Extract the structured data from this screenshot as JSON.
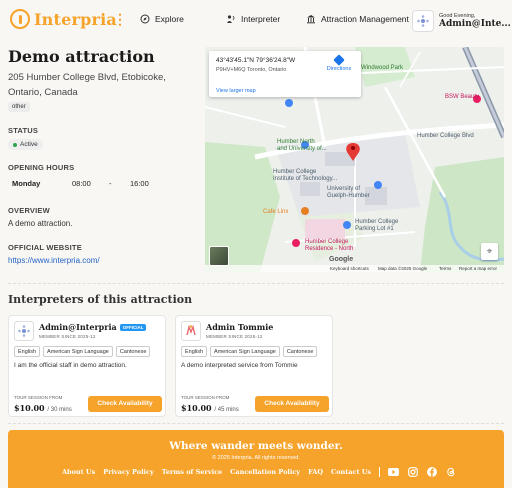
{
  "brand": {
    "name": "Interpria",
    "accent": "#f5a32b"
  },
  "nav": {
    "explore": "Explore",
    "interpreter": "Interpreter",
    "attraction_management": "Attraction Management"
  },
  "user": {
    "greeting": "Good Evening,",
    "name": "Admin@Inte..."
  },
  "attraction": {
    "title": "Demo attraction",
    "address": "205 Humber College Blvd, Etobicoke, Ontario, Canada",
    "tag": "other",
    "status_label": "STATUS",
    "status": "Active",
    "hours_label": "OPENING HOURS",
    "hours": {
      "day": "Monday",
      "open": "08:00",
      "sep": "-",
      "close": "16:00"
    },
    "overview_label": "OVERVIEW",
    "overview": "A demo attraction.",
    "website_label": "OFFICIAL WEBSITE",
    "website": "https://www.interpria.com/"
  },
  "map": {
    "coords": "43°43'45.1\"N 79°36'24.8\"W",
    "plus_code": "P9HV+M6Q Toronto, Ontario",
    "directions": "Directions",
    "larger": "View larger map",
    "labels": {
      "windwood": "Windwood Park",
      "bsw": "BSW Beauty",
      "humber_college_blvd": "Humber College Blvd",
      "humber_north": "Humber North\nand University of...",
      "humber_institute": "Humber College\nInstitute of Technology...",
      "guelph": "University of\nGuelph-Humber",
      "cafe": "Cafe Linx",
      "parking": "Humber College\nParking Lot #1",
      "residence": "Humber College\nResidence - North",
      "google": "Google"
    },
    "footer": {
      "shortcuts": "Keyboard shortcuts",
      "mapdata": "Map data ©2025 Google",
      "terms": "Terms",
      "report": "Report a map error"
    }
  },
  "interpreters": {
    "title": "Interpreters of this attraction",
    "list": [
      {
        "name": "Admin@Interpria",
        "badge": "OFFICIAL",
        "since": "MEMBER SINCE 2025-12",
        "languages": [
          "English",
          "American Sign Language",
          "Cantonese"
        ],
        "description": "I am the official staff in demo attraction.",
        "session_label": "TOUR SESSION FROM",
        "price": "$10.00",
        "duration": "/ 30 mins",
        "cta": "Check Availability"
      },
      {
        "name": "Admin Tommie",
        "badge": "",
        "since": "MEMBER SINCE 2025-12",
        "languages": [
          "English",
          "American Sign Language",
          "Cantonese"
        ],
        "description": "A demo interpreted service from Tommie",
        "session_label": "TOUR SESSION FROM",
        "price": "$10.00",
        "duration": "/ 45 mins",
        "cta": "Check Availability"
      }
    ]
  },
  "footer": {
    "tagline": "Where wander meets wonder.",
    "copyright": "© 2025 Interpria. All rights reserved.",
    "links": [
      "About Us",
      "Privacy Policy",
      "Terms of Service",
      "Cancellation Policy",
      "FAQ",
      "Contact Us"
    ],
    "social": [
      "youtube-icon",
      "instagram-icon",
      "facebook-icon",
      "threads-icon"
    ]
  }
}
